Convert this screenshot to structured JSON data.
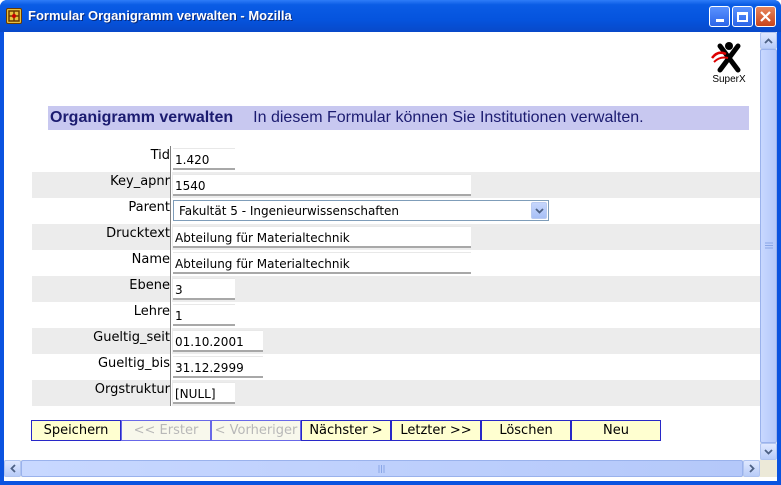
{
  "window": {
    "title": "Formular Organigramm verwalten - Mozilla"
  },
  "logo": {
    "caption": "SuperX"
  },
  "header": {
    "title": "Organigramm verwalten",
    "description": "In diesem Formular können Sie Institutionen verwalten."
  },
  "form": {
    "fields": [
      {
        "label": "Tid",
        "value": "1.420"
      },
      {
        "label": "Key_apnr",
        "value": "1540"
      },
      {
        "label": "Parent",
        "value": "Fakultät 5 - Ingenieurwissenschaften"
      },
      {
        "label": "Drucktext",
        "value": "Abteilung für Materialtechnik"
      },
      {
        "label": "Name",
        "value": "Abteilung für Materialtechnik"
      },
      {
        "label": "Ebene",
        "value": "3"
      },
      {
        "label": "Lehre",
        "value": "1"
      },
      {
        "label": "Gueltig_seit",
        "value": "01.10.2001"
      },
      {
        "label": "Gueltig_bis",
        "value": "31.12.2999"
      },
      {
        "label": "Orgstruktur",
        "value": "[NULL]"
      }
    ]
  },
  "buttons": {
    "save": "Speichern",
    "first": "<< Erster",
    "previous": "< Vorheriger",
    "next": "Nächster >",
    "last": "Letzter >>",
    "delete": "Löschen",
    "new": "Neu"
  },
  "colors": {
    "header_bg": "#c8c8f0",
    "header_text": "#1b1b70",
    "button_bg": "#ffffd0",
    "button_border": "#2828c8",
    "row_shade": "#ececec"
  }
}
